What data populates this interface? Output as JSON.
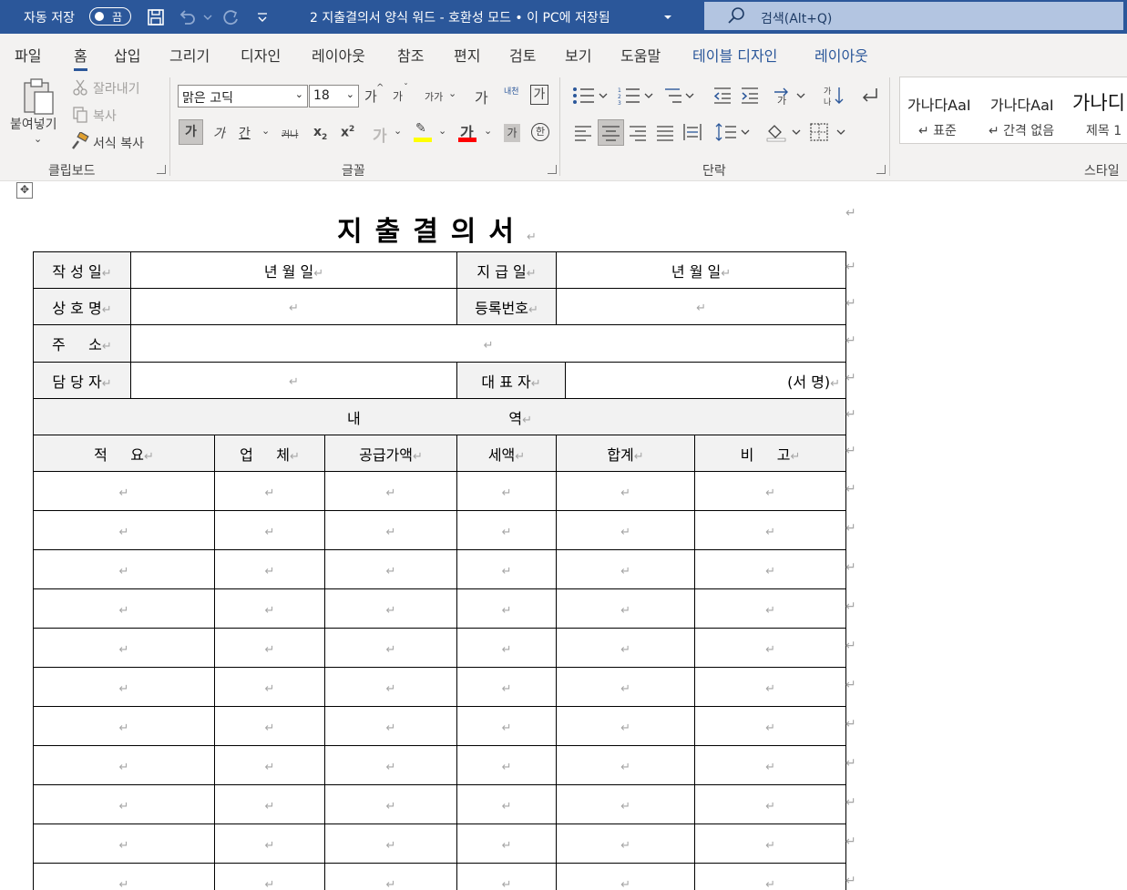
{
  "titlebar": {
    "autosave_label": "자동 저장",
    "autosave_state": "끔",
    "document_title": "2 지출결의서 양식 워드  -  호환성 모드 • 이 PC에 저장됨",
    "search_placeholder": "검색(Alt+Q)",
    "accent_color": "#2b579a"
  },
  "tabs": [
    {
      "label": "파일"
    },
    {
      "label": "홈",
      "active": true
    },
    {
      "label": "삽입"
    },
    {
      "label": "그리기"
    },
    {
      "label": "디자인"
    },
    {
      "label": "레이아웃"
    },
    {
      "label": "참조"
    },
    {
      "label": "편지"
    },
    {
      "label": "검토"
    },
    {
      "label": "보기"
    },
    {
      "label": "도움말"
    },
    {
      "label": "테이블 디자인",
      "contextual": true
    },
    {
      "label": "레이아웃",
      "contextual": true
    }
  ],
  "ribbon": {
    "clipboard": {
      "paste": "붙여넣기",
      "cut": "잘라내기",
      "copy": "복사",
      "format_painter": "서식 복사",
      "group_label": "클립보드"
    },
    "font": {
      "font_name": "맑은 고딕",
      "font_size": "18",
      "grow": "가",
      "shrink": "가",
      "change_case": "가가",
      "clear_format": "가",
      "phonetic": "내천",
      "border": "가",
      "bold": "가",
      "italic": "가",
      "underline": "간",
      "strike": "커나",
      "subscript": "x",
      "superscript": "x",
      "text_effects": "가",
      "highlight_glyph": "✎",
      "font_color": "가",
      "shading": "가",
      "enclose": "한",
      "group_label": "글꼴"
    },
    "paragraph": {
      "group_label": "단락"
    },
    "styles": {
      "items": [
        {
          "preview": "가나다AaI",
          "name": "↵ 표준"
        },
        {
          "preview": "가나다AaI",
          "name": "↵ 간격 없음"
        },
        {
          "preview": "가나디",
          "name": "제목 1"
        }
      ],
      "group_label": "스타일"
    }
  },
  "document": {
    "heading": "지출결의서",
    "para_mark": "↵",
    "rows": {
      "r1": [
        "작 성 일",
        "년    월    일",
        "지 급 일",
        "년    월    일"
      ],
      "r2": [
        "상 호 명",
        "",
        "등록번호",
        ""
      ],
      "r3": [
        "주     소",
        ""
      ],
      "r4": [
        "담 당 자",
        "",
        "대 표 자",
        "(서 명)"
      ],
      "section": "내                                역",
      "columns": [
        "적     요",
        "업     체",
        "공급가액",
        "세액",
        "합계",
        "비     고"
      ]
    },
    "empty_rows": 11
  }
}
